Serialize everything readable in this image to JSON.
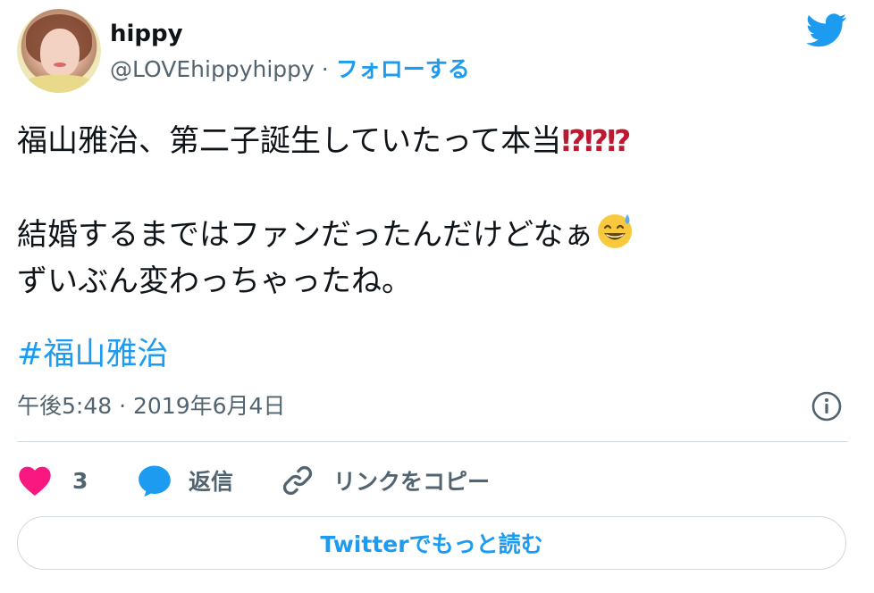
{
  "user": {
    "display_name": "hippy",
    "handle": "@LOVEhippyhippy",
    "separator": "·",
    "follow_label": "フォローする"
  },
  "tweet": {
    "line1": "福山雅治、第二子誕生していたって本当",
    "line1_emoji": "⁉⁉⁉",
    "line2": "結婚するまではファンだったんだけどなぁ",
    "line3": "ずいぶん変わっちゃったね。",
    "hashtag": "#福山雅治",
    "timestamp": "午後5:48 · 2019年6月4日"
  },
  "actions": {
    "like_count": "3",
    "reply_label": "返信",
    "copy_link_label": "リンクをコピー"
  },
  "footer": {
    "read_more_label": "Twitterでもっと読む"
  },
  "colors": {
    "accent": "#1d9bf0",
    "like": "#f91880",
    "text": "#0f1419",
    "muted": "#536471",
    "border": "#cfd9de",
    "emoji_red": "#be1931"
  },
  "icons": {
    "brand": "twitter-bird-icon",
    "info": "info-icon",
    "like": "heart-icon",
    "reply": "speech-bubble-icon",
    "copy_link": "link-icon",
    "emoji": "grinning-sweat-emoji-icon"
  }
}
